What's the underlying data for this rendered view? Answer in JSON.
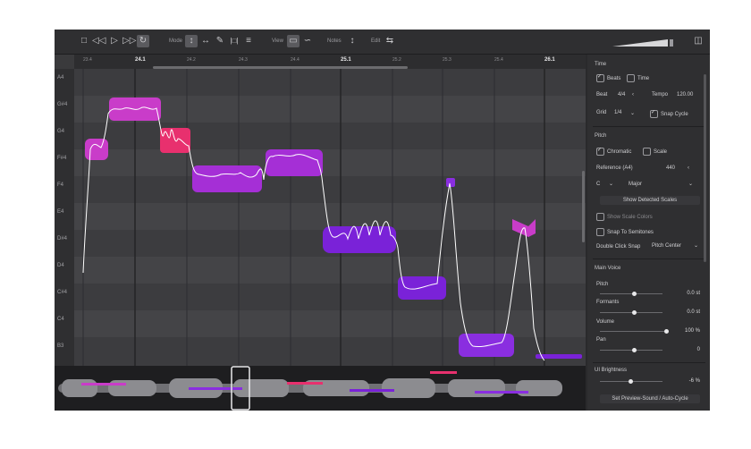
{
  "toolbar": {
    "mode_label": "Mode",
    "view_label": "View",
    "notes_label": "Notes",
    "edit_label": "Edit"
  },
  "ruler": {
    "ticks": [
      "23.4",
      "24.1",
      "24.2",
      "24.3",
      "24.4",
      "25.1",
      "25.2",
      "25.3",
      "25.4",
      "26.1"
    ]
  },
  "keys": [
    "A4",
    "G#4",
    "G4",
    "F#4",
    "F4",
    "E4",
    "D#4",
    "D4",
    "C#4",
    "C4",
    "B3"
  ],
  "sidebar": {
    "time_title": "Time",
    "beats_label": "Beats",
    "time_label": "Time",
    "beat_label": "Beat",
    "beat_value": "4/4",
    "tempo_label": "Tempo",
    "tempo_value": "120.00",
    "grid_label": "Grid",
    "grid_value": "1/4",
    "snap_cycle_label": "Snap Cycle",
    "pitch_title": "Pitch",
    "chromatic_label": "Chromatic",
    "scale_label": "Scale",
    "reference_label": "Reference (A4)",
    "reference_value": "440",
    "key_value": "C",
    "mode_value": "Major",
    "show_detected_scales": "Show Detected Scales",
    "show_scale_colors": "Show Scale Colors",
    "snap_to_semitones": "Snap To Semitones",
    "double_click_snap_label": "Double Click Snap",
    "double_click_snap_value": "Pitch Center",
    "main_voice_title": "Main Voice",
    "pitch_label": "Pitch",
    "pitch_value": "0.0 st",
    "formants_label": "Formants",
    "formants_value": "0.0 st",
    "volume_label": "Volume",
    "volume_value": "100 %",
    "pan_label": "Pan",
    "pan_value": "0",
    "ui_brightness_label": "UI Brightness",
    "ui_brightness_value": "-6 %",
    "set_preview_label": "Set Preview-Sound / Auto-Cycle"
  },
  "colors": {
    "note_magenta": "#c93cc9",
    "note_pink": "#e8306e",
    "note_purple": "#8a2ee0",
    "note_violet": "#7a22d8",
    "pitch_line": "#ffffff"
  }
}
